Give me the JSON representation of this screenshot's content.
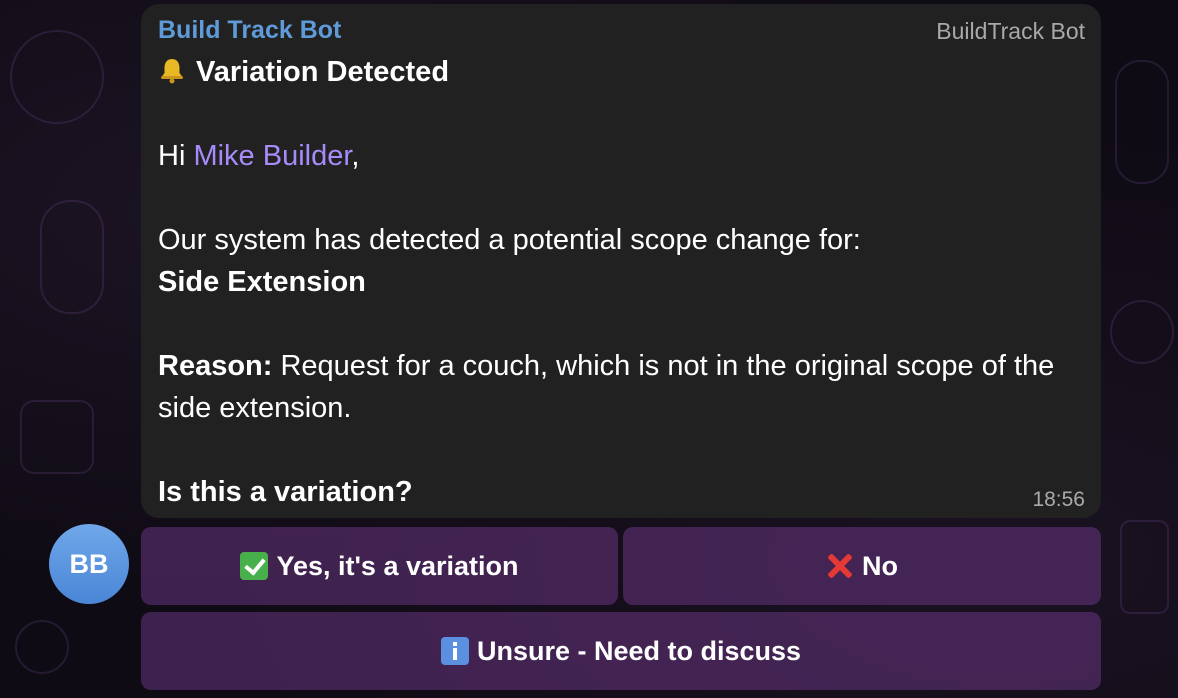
{
  "message": {
    "sender": "Build Track Bot",
    "via": "BuildTrack Bot",
    "heading": "Variation Detected",
    "greeting_prefix": "Hi ",
    "mention": "Mike Builder",
    "greeting_suffix": ",",
    "intro": "Our system has detected a potential scope change for:",
    "project": "Side Extension",
    "reason_label": "Reason:",
    "reason_text": " Request for a couch, which is not in the original scope of the side extension.",
    "question": "Is this a variation?",
    "time": "18:56"
  },
  "avatar": {
    "initials": "BB",
    "color": "#5a93dd"
  },
  "keyboard": {
    "yes_label": "Yes, it's a variation",
    "no_label": "No",
    "unsure_label": "Unsure - Need to discuss"
  },
  "icons": {
    "heading": "bell-icon",
    "yes": "check-mark-icon",
    "no": "cross-mark-icon",
    "unsure": "info-icon"
  },
  "colors": {
    "sender": "#5f9bd8",
    "mention": "#a78bfa",
    "bubble": "#212121",
    "button": "#5c2f72"
  }
}
